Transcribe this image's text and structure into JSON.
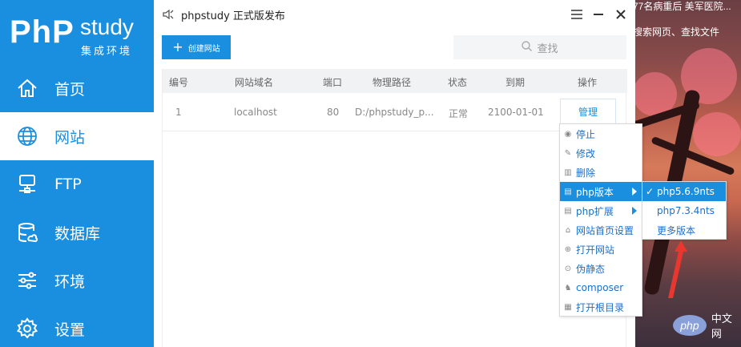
{
  "app": {
    "title": "phpstudy 正式版发布",
    "logo_php": "PhP",
    "logo_study": "study",
    "logo_sub": "集成环境"
  },
  "sidebar": {
    "items": [
      {
        "label": "首页",
        "icon": "home-icon"
      },
      {
        "label": "网站",
        "icon": "globe-icon",
        "active": true
      },
      {
        "label": "FTP",
        "icon": "ftp-server-icon"
      },
      {
        "label": "数据库",
        "icon": "database-icon"
      },
      {
        "label": "环境",
        "icon": "sliders-icon"
      },
      {
        "label": "设置",
        "icon": "gear-icon"
      }
    ]
  },
  "toolbar": {
    "create_label": "创建网站",
    "create_plus": "+",
    "search_label": "查找"
  },
  "table": {
    "headers": [
      "编号",
      "网站域名",
      "端口",
      "物理路径",
      "状态",
      "到期",
      "操作"
    ],
    "rows": [
      {
        "id": "1",
        "domain": "localhost",
        "port": "80",
        "path": "D:/phpstudy_p...",
        "status": "正常",
        "expire": "2100-01-01",
        "action": "管理"
      }
    ]
  },
  "context_menu": {
    "items": [
      {
        "label": "停止",
        "icon": "stop-icon"
      },
      {
        "label": "修改",
        "icon": "pencil-icon"
      },
      {
        "label": "删除",
        "icon": "trash-icon"
      },
      {
        "label": "php版本",
        "icon": "php-version-icon",
        "active": true,
        "has_submenu": true
      },
      {
        "label": "php扩展",
        "icon": "php-extension-icon",
        "has_submenu": true
      },
      {
        "label": "网站首页设置",
        "icon": "home-small-icon"
      },
      {
        "label": "打开网站",
        "icon": "globe-small-icon"
      },
      {
        "label": "伪静态",
        "icon": "rewrite-icon"
      },
      {
        "label": "composer",
        "icon": "composer-icon"
      },
      {
        "label": "打开根目录",
        "icon": "folder-open-icon"
      }
    ]
  },
  "submenu": {
    "items": [
      {
        "label": "php5.6.9nts",
        "active": true,
        "checked": true,
        "check_mark": "✓"
      },
      {
        "label": "php7.3.4nts"
      },
      {
        "label": "更多版本"
      }
    ]
  },
  "desktop": {
    "top_text": "77名病重后 美军医院...",
    "search_text": "搜索网页、查找文件",
    "watermark_logo": "php",
    "watermark_text": "中文网"
  },
  "colors": {
    "accent": "#1a8fe0",
    "arrow": "#e8372f"
  }
}
